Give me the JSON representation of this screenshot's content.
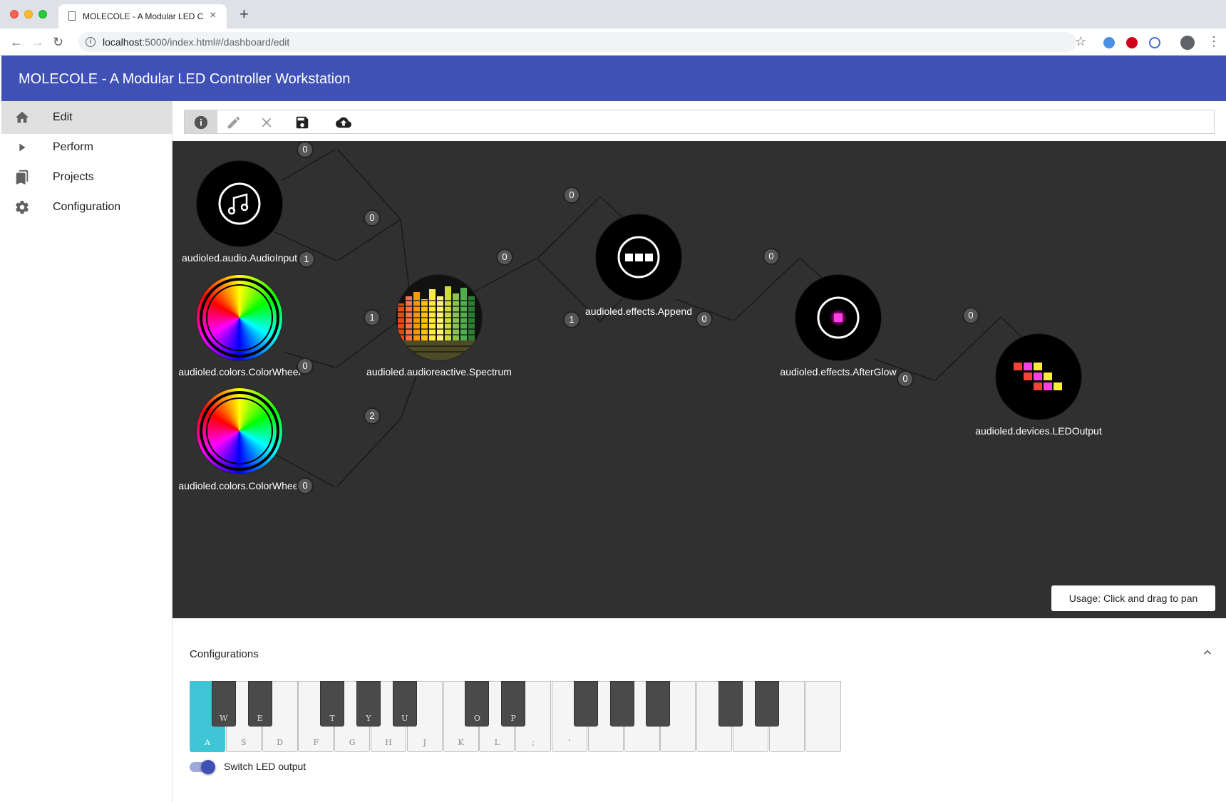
{
  "browser": {
    "tab_title": "MOLECOLE - A Modular LED C",
    "url_host": "localhost",
    "url_rest": ":5000/index.html#/dashboard/edit"
  },
  "app": {
    "title": "MOLECOLE - A Modular LED Controller Workstation"
  },
  "sidebar": {
    "items": [
      {
        "label": "Edit",
        "icon": "home-icon",
        "active": true
      },
      {
        "label": "Perform",
        "icon": "play-icon",
        "active": false
      },
      {
        "label": "Projects",
        "icon": "bookmark-icon",
        "active": false
      },
      {
        "label": "Configuration",
        "icon": "gear-icon",
        "active": false
      }
    ]
  },
  "editor_toolbar": {
    "buttons": [
      "info-icon",
      "pencil-icon",
      "close-icon",
      "save-icon",
      "cloud-upload-icon"
    ]
  },
  "graph": {
    "nodes": {
      "audio_input": "audioled.audio.AudioInput",
      "color_wheel_1": "audioled.colors.ColorWheel",
      "color_wheel_2": "audioled.colors.ColorWheel",
      "spectrum": "audioled.audioreactive.Spectrum",
      "append": "audioled.effects.Append",
      "afterglow": "audioled.effects.AfterGlow",
      "led_output": "audioled.devices.LEDOutput"
    },
    "ports": {
      "audio_out0": "0",
      "audio_out1": "1",
      "cw1_out0": "0",
      "cw2_out0": "0",
      "spec_in0": "0",
      "spec_in1": "1",
      "spec_in2": "2",
      "spec_out0": "0",
      "app_in0": "0",
      "app_in1": "1",
      "app_out0": "0",
      "ag_in0": "0",
      "ag_out0": "0",
      "led_in0": "0"
    },
    "usage": "Usage: Click and drag to pan"
  },
  "config": {
    "title": "Configurations",
    "piano": {
      "white_keys": [
        "A",
        "S",
        "D",
        "F",
        "G",
        "H",
        "J",
        "K",
        "L",
        ";",
        "'",
        "",
        "",
        "",
        "",
        "",
        "",
        ""
      ],
      "black_keys": [
        "W",
        "E",
        "T",
        "Y",
        "U",
        "O",
        "P",
        "",
        "",
        "",
        "",
        ""
      ],
      "pressed": "A"
    },
    "toggle_label": "Switch LED output",
    "toggle_on": true
  },
  "colors": {
    "accent": "#3f51b5",
    "key_pressed": "#3ec6d6",
    "canvas_bg": "#303030"
  }
}
